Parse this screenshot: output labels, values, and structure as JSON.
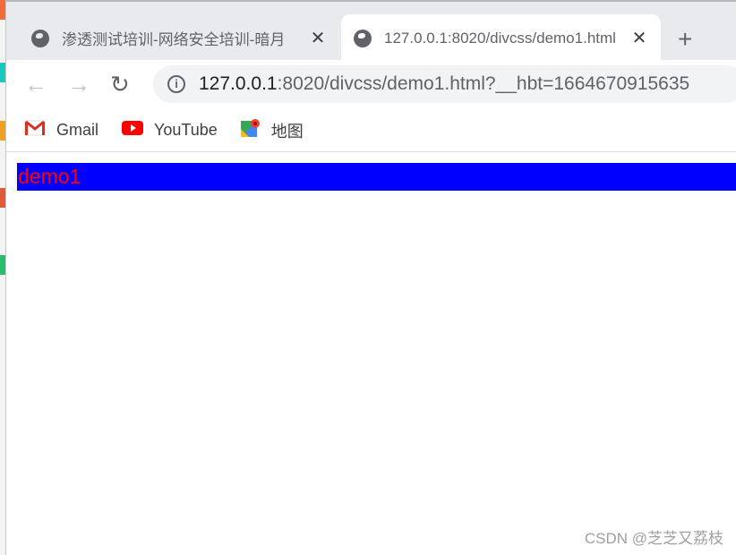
{
  "tabs": [
    {
      "title": "渗透测试培训-网络安全培训-暗月",
      "active": false
    },
    {
      "title": "127.0.0.1:8020/divcss/demo1.html",
      "active": true
    }
  ],
  "new_tab_label": "+",
  "address": {
    "host": "127.0.0.1",
    "rest": ":8020/divcss/demo1.html?__hbt=1664670915635"
  },
  "bookmarks": [
    {
      "label": "Gmail",
      "icon": "gmail-icon"
    },
    {
      "label": "YouTube",
      "icon": "youtube-icon"
    },
    {
      "label": "地图",
      "icon": "maps-icon"
    }
  ],
  "page": {
    "text": "demo1",
    "bg_color": "#0000ff",
    "text_color": "#ff0000"
  },
  "watermark": "CSDN @芝芝又荔枝"
}
